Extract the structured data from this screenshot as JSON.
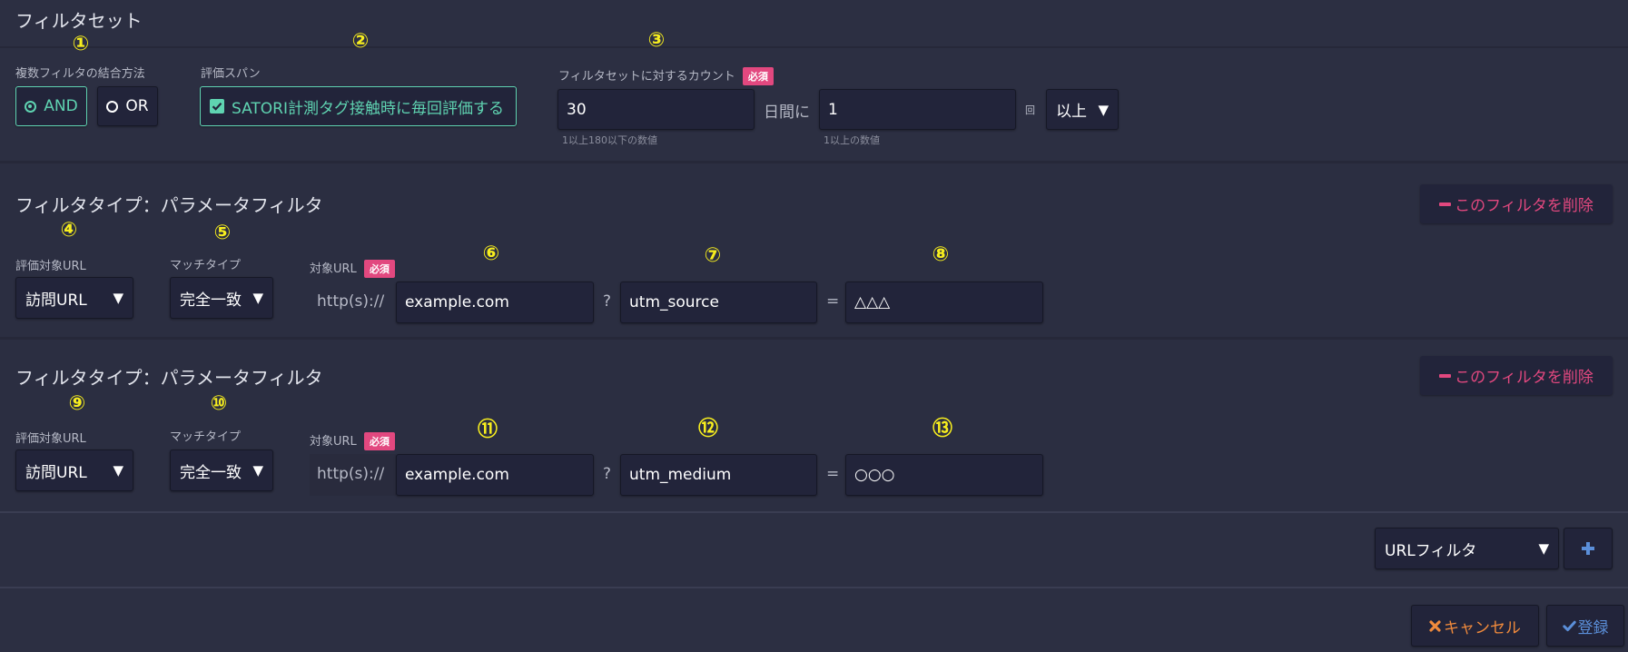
{
  "header": {
    "title": "フィルタセット"
  },
  "markers": [
    "①",
    "②",
    "③",
    "④",
    "⑤",
    "⑥",
    "⑦",
    "⑧",
    "⑨",
    "⑩",
    "⑪",
    "⑫",
    "⑬"
  ],
  "filterset": {
    "combine_label": "複数フィルタの結合方法",
    "and_label": "AND",
    "or_label": "OR",
    "selected": "AND",
    "span_label": "評価スパン",
    "span_checkbox_label": "SATORI計測タグ接触時に毎回評価する",
    "span_checked": true,
    "count_label": "フィルタセットに対するカウント",
    "required_badge": "必須",
    "days_value": "30",
    "days_suffix": "日間に",
    "days_hint": "1以上180以下の数値",
    "times_value": "1",
    "times_suffix": "回",
    "times_hint": "1以上の数値",
    "compare_value": "以上"
  },
  "filters": [
    {
      "title": "フィルタタイプ：パラメータフィルタ",
      "delete_label": "このフィルタを削除",
      "eval_url_label": "評価対象URL",
      "eval_url_value": "訪問URL",
      "match_type_label": "マッチタイプ",
      "match_type_value": "完全一致",
      "target_url_label": "対象URL",
      "required_badge": "必須",
      "protocol": "http(s)://",
      "domain_value": "example.com",
      "question": "?",
      "param_key": "utm_source",
      "equals": "=",
      "param_value": "△△△"
    },
    {
      "title": "フィルタタイプ：パラメータフィルタ",
      "delete_label": "このフィルタを削除",
      "eval_url_label": "評価対象URL",
      "eval_url_value": "訪問URL",
      "match_type_label": "マッチタイプ",
      "match_type_value": "完全一致",
      "target_url_label": "対象URL",
      "required_badge": "必須",
      "protocol": "http(s)://",
      "domain_value": "example.com",
      "question": "?",
      "param_key": "utm_medium",
      "equals": "=",
      "param_value": "○○○"
    }
  ],
  "add_filter": {
    "type_value": "URLフィルタ",
    "add_icon": "plus-icon"
  },
  "footer": {
    "cancel_label": "キャンセル",
    "submit_label": "登録",
    "cancel_icon": "x-icon",
    "submit_icon": "check-icon"
  },
  "colors": {
    "background": "#2c2f42",
    "accent_green": "#5fd3b1",
    "pink": "#e2487f",
    "orange": "#f08a3c",
    "blue": "#5b8fd9",
    "marker_yellow": "#f7ee1e"
  }
}
